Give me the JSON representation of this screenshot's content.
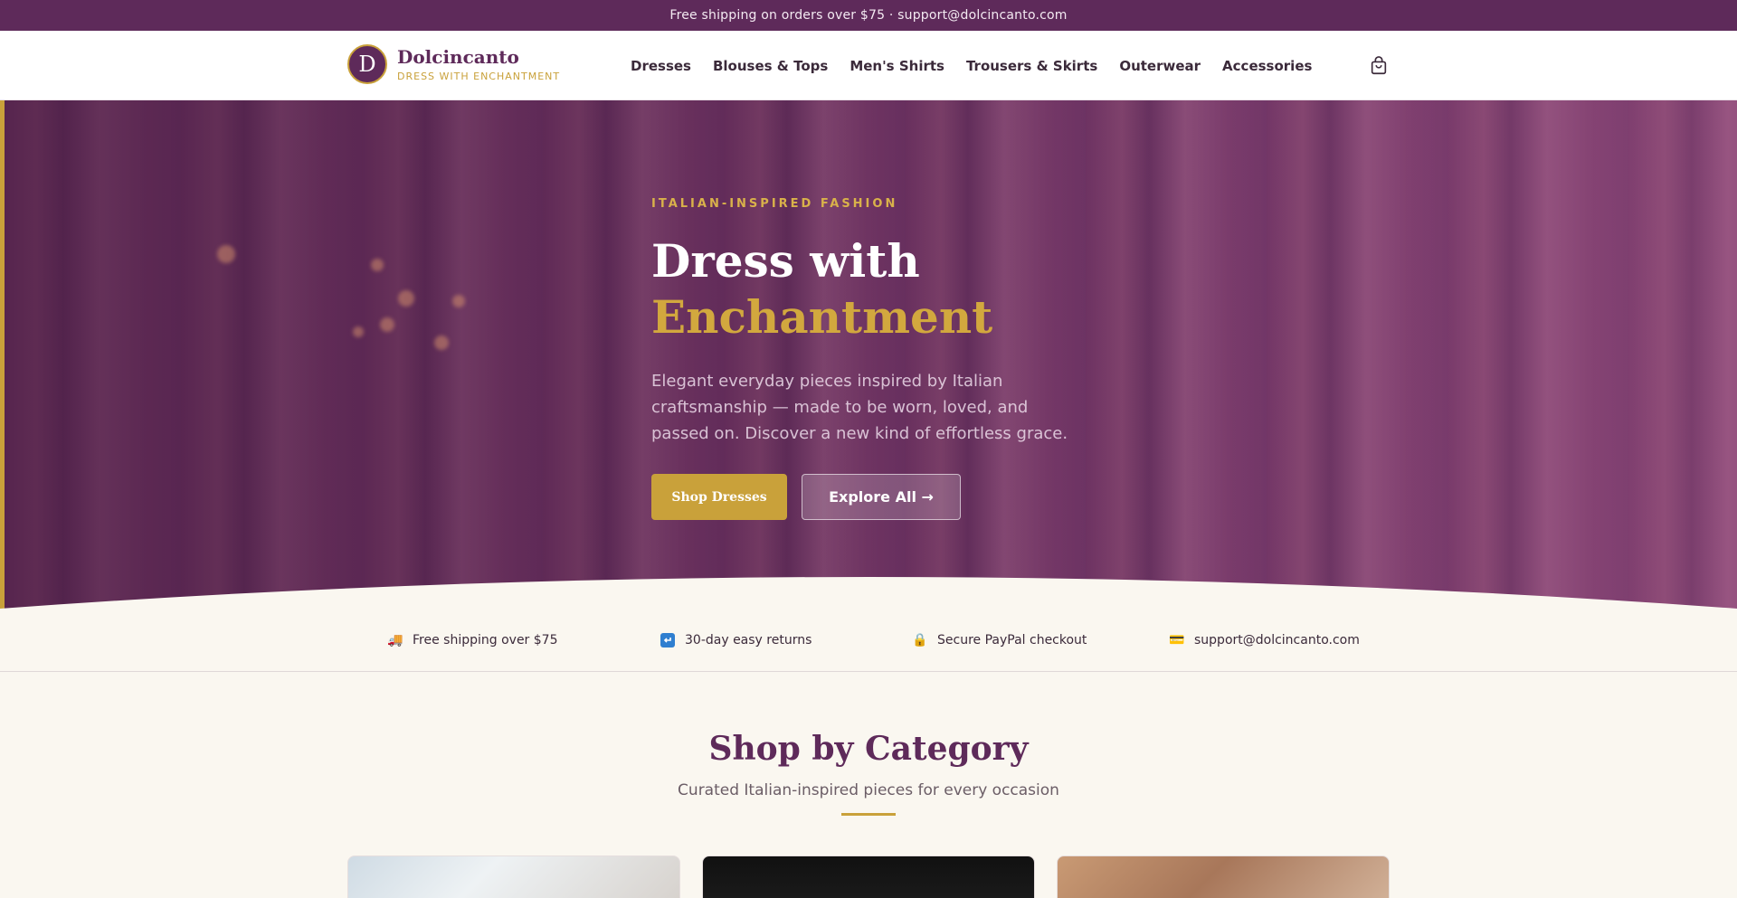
{
  "topbar": {
    "text": "Free shipping on orders over $75 · support@dolcincanto.com"
  },
  "brand": {
    "logo_letter": "D",
    "name": "Dolcincanto",
    "tagline": "DRESS WITH ENCHANTMENT"
  },
  "nav": {
    "items": [
      {
        "label": "Dresses"
      },
      {
        "label": "Blouses & Tops"
      },
      {
        "label": "Men's Shirts"
      },
      {
        "label": "Trousers & Skirts"
      },
      {
        "label": "Outerwear"
      },
      {
        "label": "Accessories"
      }
    ],
    "cart_icon": "shopping-bag-icon"
  },
  "hero": {
    "eyebrow": "ITALIAN-INSPIRED FASHION",
    "title_line1": "Dress with",
    "title_line2": "Enchantment",
    "description": "Elegant everyday pieces inspired by Italian craftsmanship — made to be worn, loved, and passed on. Discover a new kind of effortless grace.",
    "primary_cta": "Shop Dresses",
    "secondary_cta": "Explore All →"
  },
  "features": [
    {
      "icon": "truck-icon",
      "glyph": "🚚",
      "label": "Free shipping over $75"
    },
    {
      "icon": "return-icon",
      "glyph": "↩",
      "label": "30-day easy returns"
    },
    {
      "icon": "lock-icon",
      "glyph": "🔒",
      "label": "Secure PayPal checkout"
    },
    {
      "icon": "card-icon",
      "glyph": "💳",
      "label": "support@dolcincanto.com"
    }
  ],
  "categories": {
    "title": "Shop by Category",
    "subtitle": "Curated Italian-inspired pieces for every occasion"
  },
  "colors": {
    "brand_purple": "#5e2a5a",
    "gold": "#c9a13a",
    "cream": "#faf7f0"
  }
}
